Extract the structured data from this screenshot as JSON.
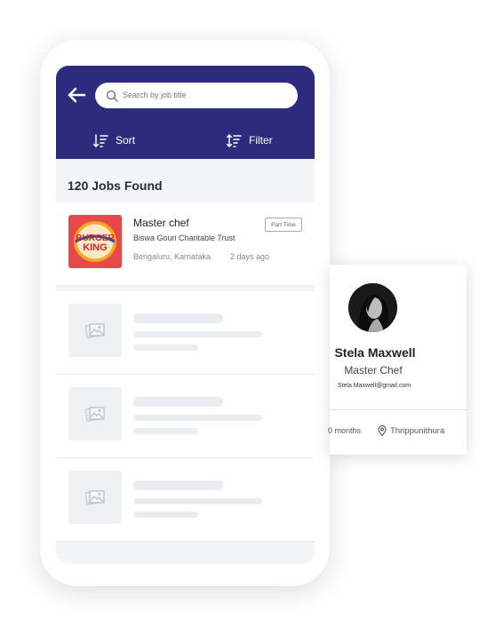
{
  "search": {
    "placeholder": "Search by job title"
  },
  "toolbar": {
    "sort_label": "Sort",
    "filter_label": "Filter"
  },
  "results": {
    "count_label": "120 Jobs Found"
  },
  "job": {
    "title": "Master chef",
    "company": "Biswa Gouri Charitable Trust",
    "location": "Bengaluru, Karnataka",
    "posted": "2 days ago",
    "type_badge": "Part Time",
    "logo_text_top": "BURGER",
    "logo_text_bottom": "KING"
  },
  "profile": {
    "name": "Stela Maxwell",
    "role": "Master Chef",
    "email": "Stela Maxwell@gmail.com",
    "experience": "0 months",
    "location": "Thrippunithura"
  },
  "colors": {
    "header": "#2e2a7e",
    "logo_bg": "#e8484a",
    "placeholder": "#e9ecf1"
  }
}
